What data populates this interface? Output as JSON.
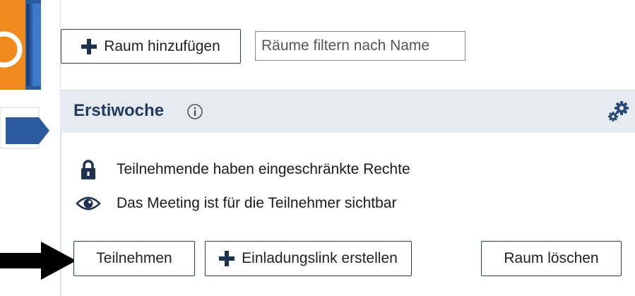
{
  "toolbar": {
    "add_room_label": "Raum hinzufügen",
    "filter_placeholder": "Räume filtern nach Name"
  },
  "room": {
    "title": "Erstiwoche",
    "info_rows": [
      {
        "icon": "lock-icon",
        "text": "Teilnehmende haben eingeschränkte Rechte"
      },
      {
        "icon": "eye-icon",
        "text": "Das Meeting ist für die Teilnehmer sichtbar"
      }
    ],
    "buttons": {
      "join": "Teilnehmen",
      "invite": "Einladungslink erstellen",
      "delete": "Raum löschen"
    }
  },
  "colors": {
    "brand_orange": "#f08a1c",
    "brand_blue": "#2c5a9e",
    "header_bg": "#e6eaf1",
    "title_color": "#223a5e",
    "button_border": "#2a3f63"
  }
}
